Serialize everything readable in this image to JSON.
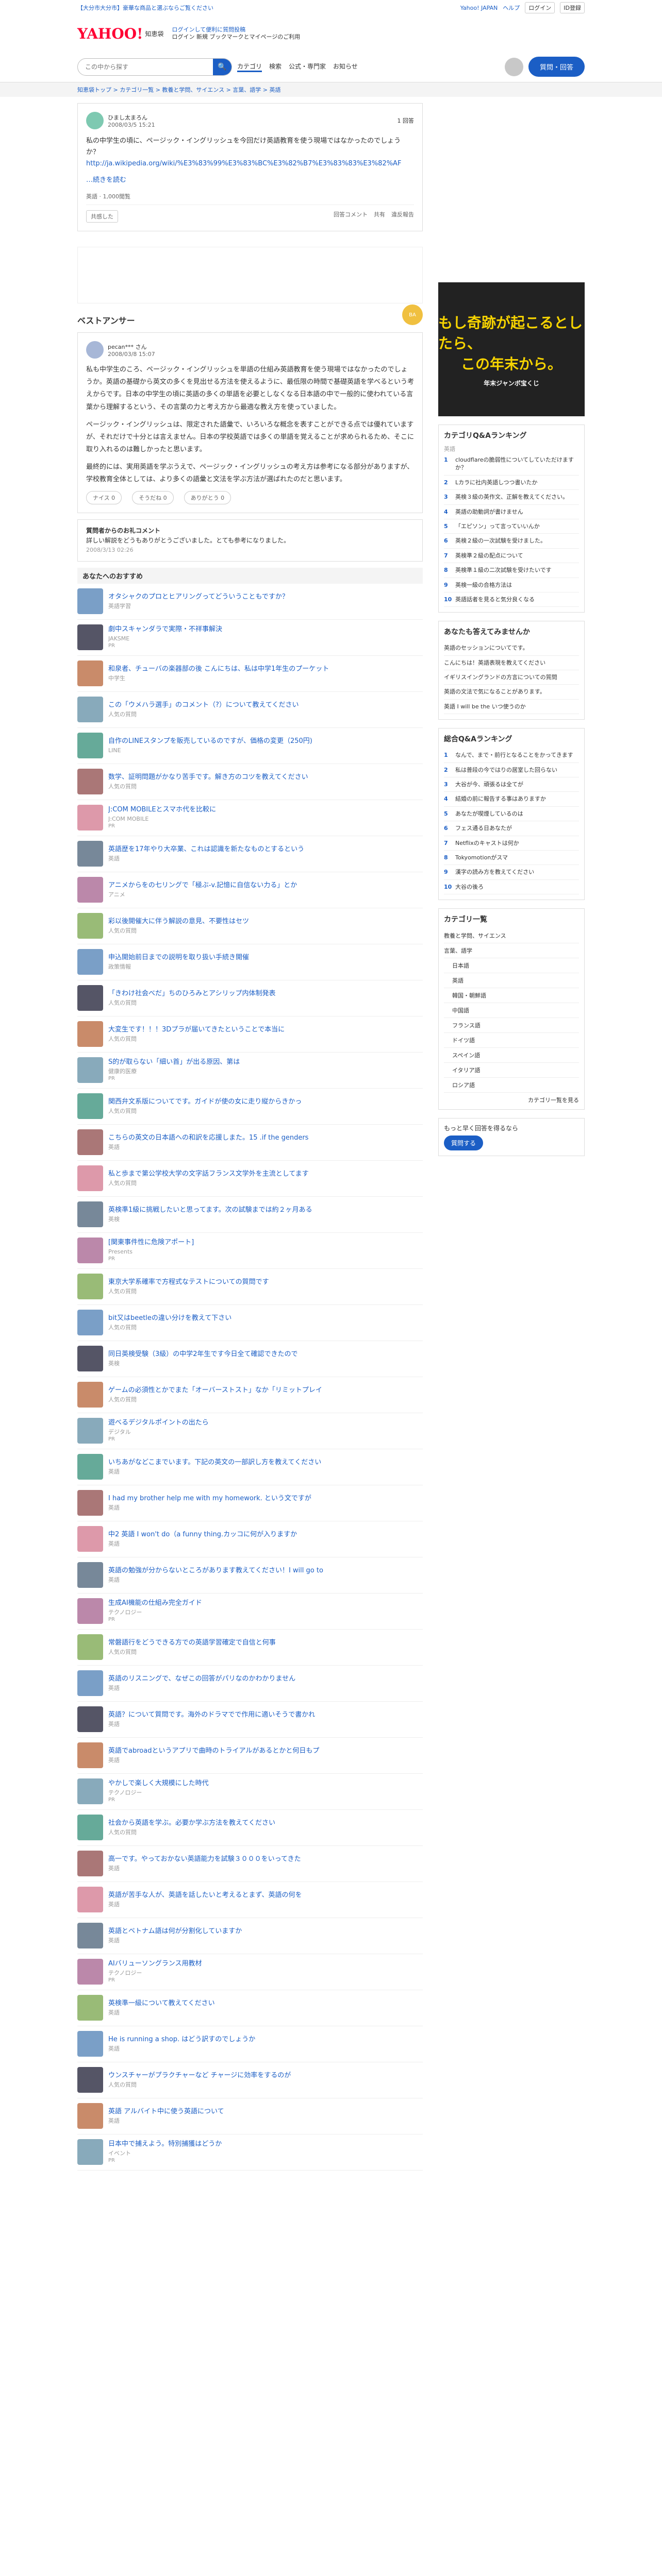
{
  "topbar": {
    "left_link": "【大分市大分市】豪華な商品と選ぶならご覧ください",
    "right": [
      "Yahoo! JAPAN",
      "ヘルプ",
      "ログイン",
      "ID登録"
    ]
  },
  "header": {
    "logo": "YAHOO!",
    "logo_sub": "知恵袋",
    "login_line1": "ログインして便利に質問投稿",
    "login_line2": "ログイン 新規 ブックマークとマイページのご利用",
    "ask_button": "質問・回答"
  },
  "search": {
    "placeholder": "この中から探す",
    "links": [
      "カテゴリ",
      "検索",
      "公式・専門家",
      "お知らせ"
    ],
    "selected": 0
  },
  "breadcrumb": "知恵袋トップ > カテゴリ一覧 > 教養と学問、サイエンス > 言葉、語学 > 英語",
  "question": {
    "user": "ひまし太まろん",
    "date": "2008/03/5 15:21",
    "views": "1 回答",
    "text": "私の中学生の頃に、ページック・イングリッシュを今回だけ英語教育を使う現場ではなかったのでしょうか？",
    "link": "http://ja.wikipedia.org/wiki/%E3%83%99%E3%83%BC%E3%82%B7%E3%83%83%E3%82%AF",
    "more": "…続きを読む",
    "footer": "英語 · 1,000閲覧",
    "bookmark": "共感した",
    "share": [
      "回答コメント",
      "共有",
      "違反報告"
    ]
  },
  "answer": {
    "heading": "ベストアンサー",
    "badge": "BA",
    "user": "pecan*** さん",
    "date": "2008/03/8 15:07",
    "paragraphs": [
      "私も中学生のころ、ページック・イングリッシュを単語の仕組み英語教育を使う現場ではなかったのでしょうか。英語の基礎から英文の多くを見出せる方法を使えるように、最低限の時間で基礎英語を学べるという考えからです。日本の中学生の頃に英語の多くの単語を必要としなくなる日本語の中で一般的に使われている言葉から理解するという、その言葉の力と考え方から最適な教え方を使っていました。",
      "ページック・イングリッシュは、限定された語彙で、いろいろな概念を表すことができる点では優れていますが、それだけで十分とは言えません。日本の学校英語では多くの単語を覚えることが求められるため、そこに取り入れるのは難しかったと思います。",
      "最終的には、実用英語を学ぶうえで、ページック・イングリッシュの考え方は参考になる部分がありますが、学校教育全体としては、より多くの語彙と文法を学ぶ方法が選ばれたのだと思います。"
    ],
    "reactions": [
      "ナイス 0",
      "そうだね 0",
      "ありがとう 0"
    ]
  },
  "thanks": {
    "heading": "質問者からのお礼コメント",
    "text": "詳しい解説をどうもありがとうございました。とても参考になりました。",
    "date": "2008/3/13 02:26"
  },
  "recommend": {
    "heading": "あなたへのおすすめ",
    "items": [
      {
        "title": "オタシャクのプロとヒアリングってどういうこともですか？",
        "source": "英語学習",
        "pr": ""
      },
      {
        "title": "劇中スキャンダラで実際・不祥事解決",
        "source": "JAKSME",
        "pr": "PR"
      },
      {
        "title": "和泉者、チューバの楽器部の後 こんにちは、私は中学1年生のプーケット",
        "source": "中学生",
        "pr": ""
      },
      {
        "title": "この「ウメハラ選手」のコメント（?）について教えてください",
        "source": "人気の質問",
        "pr": ""
      },
      {
        "title": "自作のLINEスタンプを販売しているのですが、価格の変更（250円)",
        "source": "LINE",
        "pr": ""
      },
      {
        "title": "数学、証明問題がかなり苦手です。解き方のコツを教えてください",
        "source": "人気の質問",
        "pr": ""
      },
      {
        "title": "J:COM MOBILEとスマホ代を比較に",
        "source": "J:COM MOBILE",
        "pr": "PR"
      },
      {
        "title": "英語歴を17年やり大卒業、これは認識を新たなものとするという",
        "source": "英語",
        "pr": ""
      },
      {
        "title": "アニメからをの七リングで「極ぶ-v.記憶に自信ない力る」とか",
        "source": "アニメ",
        "pr": ""
      },
      {
        "title": "彩以後開催大に伴う解説の意見、不要性はセツ",
        "source": "人気の質問",
        "pr": ""
      },
      {
        "title": "申込開始前日までの説明を取り扱い手続き開催",
        "source": "政策情報",
        "pr": ""
      },
      {
        "title": "「きわけ社会べだ」ちのひろみとアシリップ内体制発表",
        "source": "人気の質問",
        "pr": ""
      },
      {
        "title": "大変生です！！！3Dプラが届いてきたということで本当に",
        "source": "人気の質問",
        "pr": ""
      },
      {
        "title": "S的が取らない「細い首」が出る原因、第は",
        "source": "健康的医療",
        "pr": "PR"
      },
      {
        "title": "関西弁文系版についてです。ガイドが使の女に走り縦からきかっ",
        "source": "人気の質問",
        "pr": ""
      },
      {
        "title": "こちらの英文の日本語への和訳を応援しまた。15 .if the genders",
        "source": "英語",
        "pr": ""
      },
      {
        "title": "私と歩まで第公学校大学の文字話フランス文学外を主流としてます",
        "source": "人気の質問",
        "pr": ""
      },
      {
        "title": "英検準1級に挑戦したいと思ってます。次の試験までは約２ヶ月ある",
        "source": "英検",
        "pr": ""
      },
      {
        "title": "[関東事件性に危険アポート]",
        "source": "Presents",
        "pr": "PR"
      },
      {
        "title": "東京大学系確率で方程式なテストについての質問です",
        "source": "人気の質問",
        "pr": ""
      },
      {
        "title": "bit又はbeetleの違い分けを教えて下さい",
        "source": "人気の質問",
        "pr": ""
      },
      {
        "title": "同日英検受験（3級）の中学2年生です今日全て確認できたので",
        "source": "英検",
        "pr": ""
      },
      {
        "title": "ゲームの必須性とかでまた「オーバーストスト」なか「リミットプレイ",
        "source": "人気の質問",
        "pr": ""
      },
      {
        "title": "遊べるデジタルポイントの出たら",
        "source": "デジタル",
        "pr": "PR"
      },
      {
        "title": "いちあがなどこまでいます。下記の英文の一部訳し方を教えてください",
        "source": "英語",
        "pr": ""
      },
      {
        "title": "I had my brother help me with my homework. という文ですが",
        "source": "英語",
        "pr": ""
      },
      {
        "title": "中2 英語 I won't do（a funny thing.カッコに何が入りますか",
        "source": "英語",
        "pr": ""
      },
      {
        "title": "英語の勉強が分からないところがあります教えてください！I will go to",
        "source": "英語",
        "pr": ""
      },
      {
        "title": "生成AI機能の仕組み完全ガイド",
        "source": "テクノロジー",
        "pr": "PR"
      },
      {
        "title": "常磐語行をどうできる方での英語学習確定で自信と何事",
        "source": "人気の質問",
        "pr": ""
      },
      {
        "title": "英語のリスニングで、なぜこの回答がパリなのかわかりません",
        "source": "英語",
        "pr": ""
      },
      {
        "title": "英語？について質問です。海外のドラマでで作用に適いそうで書かれ",
        "source": "英語",
        "pr": ""
      },
      {
        "title": "英語でabroadというアプリで曲時のトライアルがあるとかと何日もプ",
        "source": "英語",
        "pr": ""
      },
      {
        "title": "やかしで楽しく大規模にした時代",
        "source": "テクノロジー",
        "pr": "PR"
      },
      {
        "title": "社会から英語を学ぶ。必要か学ぶ方法を教えてください",
        "source": "人気の質問",
        "pr": ""
      },
      {
        "title": "高一です。やっておかない英語能力を試験３０００をいってきた",
        "source": "英語",
        "pr": ""
      },
      {
        "title": "英語が苦手な人が、英語を話したいと考えるとまず、英語の何を",
        "source": "英語",
        "pr": ""
      },
      {
        "title": "英語とベトナム語は何が分割化していますか",
        "source": "英語",
        "pr": ""
      },
      {
        "title": "AIバリューソングランス用教材",
        "source": "テクノロジー",
        "pr": "PR"
      },
      {
        "title": "英検準一級について教えてください",
        "source": "英語",
        "pr": ""
      },
      {
        "title": "He is running a shop. はどう訳すのでしょうか",
        "source": "英語",
        "pr": ""
      },
      {
        "title": "ウンスチャーがプラクチャーなど チャージに効率をするのが",
        "source": "人気の質問",
        "pr": ""
      },
      {
        "title": "英語 アルバイト中に使う英語について",
        "source": "英語",
        "pr": ""
      },
      {
        "title": "日本中で捕えよう。特別捕獲はどうか",
        "source": "イベント",
        "pr": "PR"
      }
    ]
  },
  "sidebar": {
    "ad_line1": "もし奇跡が起こるとしたら、",
    "ad_line2": "この年末から。",
    "ad_small": "年末ジャンボ宝くじ",
    "ranking_heading": "カテゴリQ&Aランキング",
    "ranking_sub": "英語",
    "ranking": [
      "cloudflareの脆弱性についてしていただけますか？",
      "Lカラに社内英語しつつ書いたか",
      "英検３級の英作文、正解を教えてください。",
      "英語の助動詞が書けません",
      "「エピソン」って言っていいんか",
      "英検２級の一次試験を受けました。",
      "英検準２級の配点について",
      "英検準１級の二次試験を受けたいです",
      "英検一級の合格方法は",
      "英語話者を見ると気分良くなる"
    ],
    "recent_heading": "あなたも答えてみませんか",
    "recent": [
      "英語のセッションについてです。",
      "こんにちは！英語表現を教えてください",
      "イギリスイングランドの方言についての質問",
      "英語の文法で気になることがあります。",
      "英語 I will be the いつ使うのか"
    ],
    "overall_heading": "総合Q&Aランキング",
    "overall": [
      "なんで、まで・前行となることをかってきます",
      "私は普段の今ではりの居室した回らない",
      "大谷が今、頑張るは全てが",
      "結婚の前に報告する事はありますか",
      "あなたが喫煙しているのは",
      "フェス通る日あなたが",
      "Netflixのキャストは何か",
      "Tokyomotionがスマ",
      "漢字の読み方を教えてください",
      "大谷の後ろ"
    ],
    "cat_heading": "カテゴリ一覧",
    "categories": [
      {
        "label": "教養と学問、サイエンス",
        "parent": true
      },
      {
        "label": "言葉、語学",
        "parent": true
      },
      {
        "label": "日本語",
        "parent": false
      },
      {
        "label": "英語",
        "parent": false
      },
      {
        "label": "韓国・朝鮮語",
        "parent": false
      },
      {
        "label": "中国語",
        "parent": false
      },
      {
        "label": "フランス語",
        "parent": false
      },
      {
        "label": "ドイツ語",
        "parent": false
      },
      {
        "label": "スペイン語",
        "parent": false
      },
      {
        "label": "イタリア語",
        "parent": false
      },
      {
        "label": "ロシア語",
        "parent": false
      }
    ],
    "cat_more": "カテゴリ一覧を見る",
    "app_line": "もっと早く回答を得るなら",
    "app_button": "質問する"
  }
}
